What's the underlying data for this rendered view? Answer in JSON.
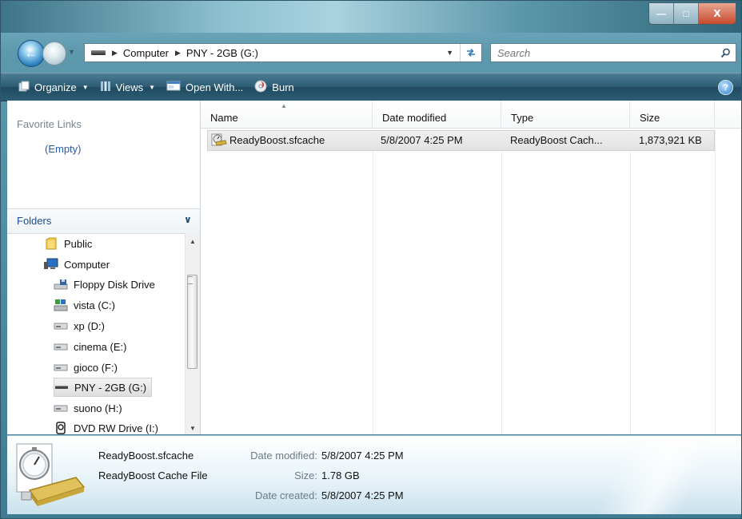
{
  "window": {
    "minimize_glyph": "—",
    "maximize_glyph": "□",
    "close_glyph": "X"
  },
  "address": {
    "crumbs": [
      "Computer",
      "PNY - 2GB (G:)"
    ],
    "search_placeholder": "Search"
  },
  "toolbar": {
    "organize": "Organize",
    "views": "Views",
    "open_with": "Open With...",
    "burn": "Burn"
  },
  "nav": {
    "favorite_links": "Favorite Links",
    "favorites_empty": "(Empty)",
    "folders": "Folders",
    "tree": [
      {
        "label": "Public",
        "icon": "folder-icon"
      },
      {
        "label": "Computer",
        "icon": "computer-icon"
      },
      {
        "label": "Floppy Disk Drive",
        "icon": "floppy-drive-icon"
      },
      {
        "label": "vista (C:)",
        "icon": "system-drive-icon"
      },
      {
        "label": "xp (D:)",
        "icon": "hard-drive-icon"
      },
      {
        "label": "cinema (E:)",
        "icon": "hard-drive-icon"
      },
      {
        "label": "gioco (F:)",
        "icon": "hard-drive-icon"
      },
      {
        "label": "PNY - 2GB (G:)",
        "icon": "usb-drive-icon"
      },
      {
        "label": "suono (H:)",
        "icon": "hard-drive-icon"
      },
      {
        "label": "DVD RW Drive (I:)",
        "icon": "dvd-drive-icon"
      }
    ]
  },
  "list": {
    "columns": [
      "Name",
      "Date modified",
      "Type",
      "Size"
    ],
    "rows": [
      {
        "name": "ReadyBoost.sfcache",
        "date_modified": "5/8/2007 4:25 PM",
        "type": "ReadyBoost Cach...",
        "size": "1,873,921 KB"
      }
    ]
  },
  "details": {
    "file_name": "ReadyBoost.sfcache",
    "file_type": "ReadyBoost Cache File",
    "date_modified_label": "Date modified:",
    "date_modified": "5/8/2007 4:25 PM",
    "size_label": "Size:",
    "size": "1.78 GB",
    "date_created_label": "Date created:",
    "date_created": "5/8/2007 4:25 PM"
  }
}
